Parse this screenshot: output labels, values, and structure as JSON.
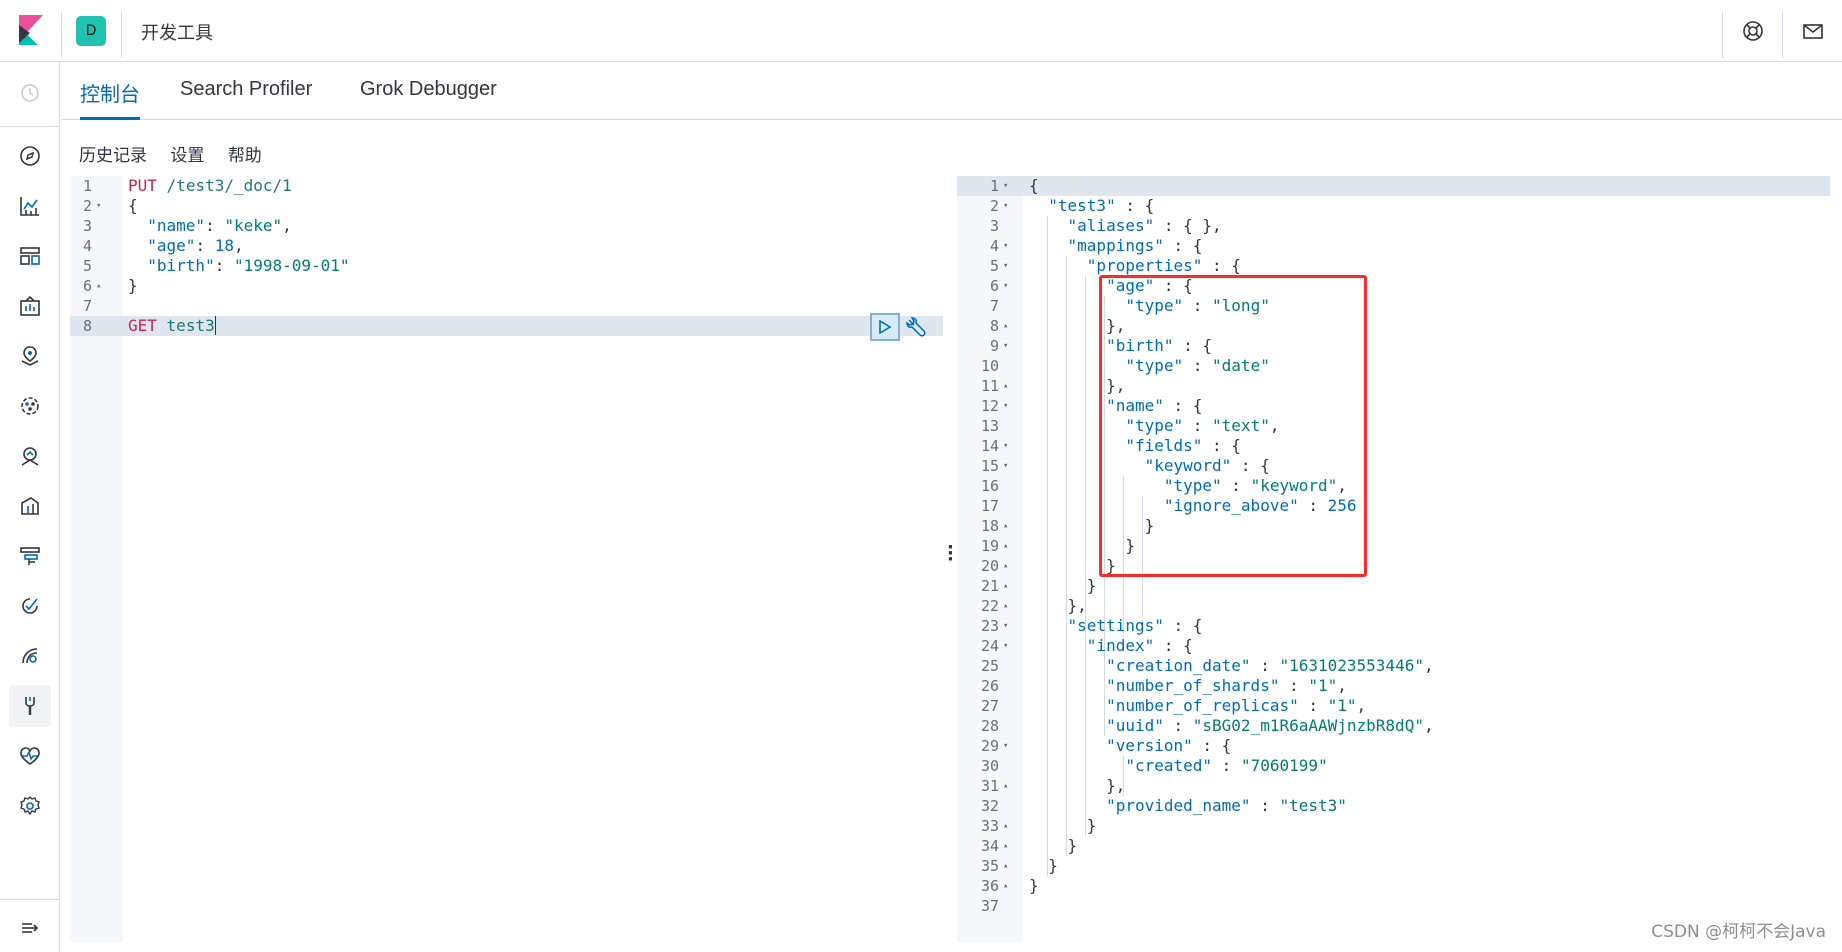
{
  "header": {
    "space_initial": "D",
    "title": "开发工具"
  },
  "tabs": [
    {
      "label": "控制台"
    },
    {
      "label": "Search Profiler"
    },
    {
      "label": "Grok Debugger"
    }
  ],
  "toolbar": {
    "history": "历史记录",
    "settings": "设置",
    "help": "帮助"
  },
  "request_lines": [
    {
      "n": "1",
      "fold": "",
      "text": ""
    },
    {
      "n": "2",
      "fold": "▾",
      "text": "{"
    },
    {
      "n": "3",
      "fold": "",
      "text": ""
    },
    {
      "n": "4",
      "fold": "",
      "text": ""
    },
    {
      "n": "5",
      "fold": "",
      "text": ""
    },
    {
      "n": "6",
      "fold": "▴",
      "text": "}"
    },
    {
      "n": "7",
      "fold": "",
      "text": ""
    },
    {
      "n": "8",
      "fold": "",
      "text": ""
    }
  ],
  "request": {
    "line1_method": "PUT",
    "line1_url": "/test3/_doc/1",
    "line3_key": "\"name\"",
    "line3_val": "\"keke\"",
    "line4_key": "\"age\"",
    "line4_val": "18",
    "line5_key": "\"birth\"",
    "line5_val": "\"1998-09-01\"",
    "line8_method": "GET",
    "line8_url": "test3"
  },
  "response_lines": [
    {
      "n": "1",
      "fold": "▾"
    },
    {
      "n": "2",
      "fold": "▾"
    },
    {
      "n": "3",
      "fold": ""
    },
    {
      "n": "4",
      "fold": "▾"
    },
    {
      "n": "5",
      "fold": "▾"
    },
    {
      "n": "6",
      "fold": "▾"
    },
    {
      "n": "7",
      "fold": ""
    },
    {
      "n": "8",
      "fold": "▴"
    },
    {
      "n": "9",
      "fold": "▾"
    },
    {
      "n": "10",
      "fold": ""
    },
    {
      "n": "11",
      "fold": "▴"
    },
    {
      "n": "12",
      "fold": "▾"
    },
    {
      "n": "13",
      "fold": ""
    },
    {
      "n": "14",
      "fold": "▾"
    },
    {
      "n": "15",
      "fold": "▾"
    },
    {
      "n": "16",
      "fold": ""
    },
    {
      "n": "17",
      "fold": ""
    },
    {
      "n": "18",
      "fold": "▴"
    },
    {
      "n": "19",
      "fold": "▴"
    },
    {
      "n": "20",
      "fold": "▴"
    },
    {
      "n": "21",
      "fold": "▴"
    },
    {
      "n": "22",
      "fold": "▴"
    },
    {
      "n": "23",
      "fold": "▾"
    },
    {
      "n": "24",
      "fold": "▾"
    },
    {
      "n": "25",
      "fold": ""
    },
    {
      "n": "26",
      "fold": ""
    },
    {
      "n": "27",
      "fold": ""
    },
    {
      "n": "28",
      "fold": ""
    },
    {
      "n": "29",
      "fold": "▾"
    },
    {
      "n": "30",
      "fold": ""
    },
    {
      "n": "31",
      "fold": "▴"
    },
    {
      "n": "32",
      "fold": ""
    },
    {
      "n": "33",
      "fold": "▴"
    },
    {
      "n": "34",
      "fold": "▴"
    },
    {
      "n": "35",
      "fold": "▴"
    },
    {
      "n": "36",
      "fold": "▴"
    },
    {
      "n": "37",
      "fold": ""
    }
  ],
  "response": {
    "l1": "{",
    "l2k": "\"test3\"",
    "l2p": " : {",
    "l3k": "\"aliases\"",
    "l3p": " : { },",
    "l4k": "\"mappings\"",
    "l4p": " : {",
    "l5k": "\"properties\"",
    "l5p": " : {",
    "l6k": "\"age\"",
    "l6p": " : {",
    "l7k": "\"type\"",
    "l7s": " : ",
    "l7v": "\"long\"",
    "l8": "},",
    "l9k": "\"birth\"",
    "l9p": " : {",
    "l10k": "\"type\"",
    "l10s": " : ",
    "l10v": "\"date\"",
    "l11": "},",
    "l12k": "\"name\"",
    "l12p": " : {",
    "l13k": "\"type\"",
    "l13s": " : ",
    "l13v": "\"text\"",
    "l13e": ",",
    "l14k": "\"fields\"",
    "l14p": " : {",
    "l15k": "\"keyword\"",
    "l15p": " : {",
    "l16k": "\"type\"",
    "l16s": " : ",
    "l16v": "\"keyword\"",
    "l16e": ",",
    "l17k": "\"ignore_above\"",
    "l17s": " : ",
    "l17v": "256",
    "l18": "}",
    "l19": "}",
    "l20": "}",
    "l21": "}",
    "l22": "},",
    "l23k": "\"settings\"",
    "l23p": " : {",
    "l24k": "\"index\"",
    "l24p": " : {",
    "l25k": "\"creation_date\"",
    "l25s": " : ",
    "l25v": "\"1631023553446\"",
    "l25e": ",",
    "l26k": "\"number_of_shards\"",
    "l26s": " : ",
    "l26v": "\"1\"",
    "l26e": ",",
    "l27k": "\"number_of_replicas\"",
    "l27s": " : ",
    "l27v": "\"1\"",
    "l27e": ",",
    "l28k": "\"uuid\"",
    "l28s": " : ",
    "l28v": "\"sBG02_m1R6aAAWjnzbR8dQ\"",
    "l28e": ",",
    "l29k": "\"version\"",
    "l29p": " : {",
    "l30k": "\"created\"",
    "l30s": " : ",
    "l30v": "\"7060199\"",
    "l31": "},",
    "l32k": "\"provided_name\"",
    "l32s": " : ",
    "l32v": "\"test3\"",
    "l33": "}",
    "l34": "}",
    "l35": "}",
    "l36": "}"
  },
  "watermark": "CSDN @柯柯不会Java",
  "colors": {
    "accent": "#006bb8",
    "space_avatar": "#20c2b2",
    "highlight_box": "#ff2a2a"
  },
  "icons": {
    "nav": [
      "clock-icon",
      "compass-icon",
      "chart-icon",
      "dashboard-icon",
      "canvas-icon",
      "maps-icon",
      "ml-icon",
      "infrastructure-icon",
      "logs-icon",
      "apm-icon",
      "uptime-icon",
      "siem-icon",
      "dev-tools-icon",
      "monitoring-icon",
      "management-icon",
      "collapse-icon"
    ]
  }
}
